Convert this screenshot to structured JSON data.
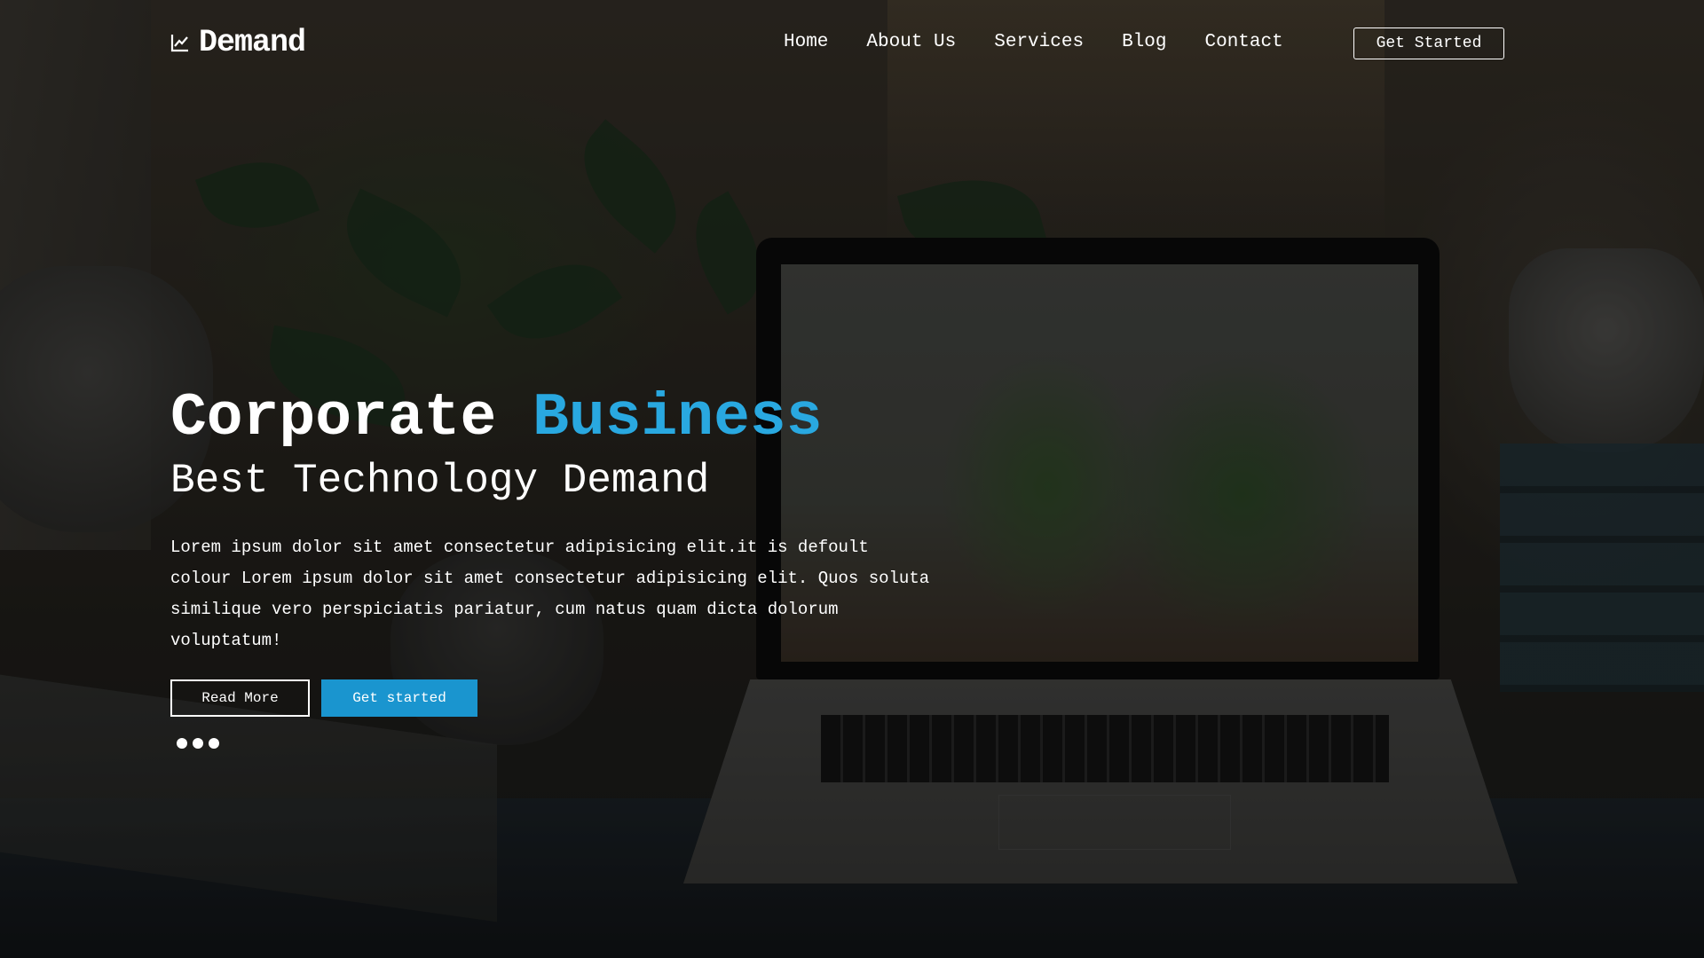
{
  "brand": {
    "name": "Demand",
    "icon": "line-chart-icon"
  },
  "nav": {
    "items": [
      {
        "label": "Home"
      },
      {
        "label": "About Us"
      },
      {
        "label": "Services"
      },
      {
        "label": "Blog"
      },
      {
        "label": "Contact"
      }
    ],
    "cta_label": "Get Started"
  },
  "hero": {
    "title_main": "Corporate",
    "title_accent": "Business",
    "subtitle": "Best Technology Demand",
    "body": "Lorem ipsum dolor sit amet consectetur adipisicing elit.it is defoult colour Lorem ipsum dolor sit amet consectetur adipisicing elit. Quos soluta similique vero perspiciatis pariatur, cum natus quam dicta dolorum voluptatum!",
    "read_more_label": "Read More",
    "get_started_label": "Get started",
    "slides": 3
  },
  "colors": {
    "accent": "#29a8e0",
    "primary_button": "#1a95cf",
    "text": "#ffffff"
  }
}
